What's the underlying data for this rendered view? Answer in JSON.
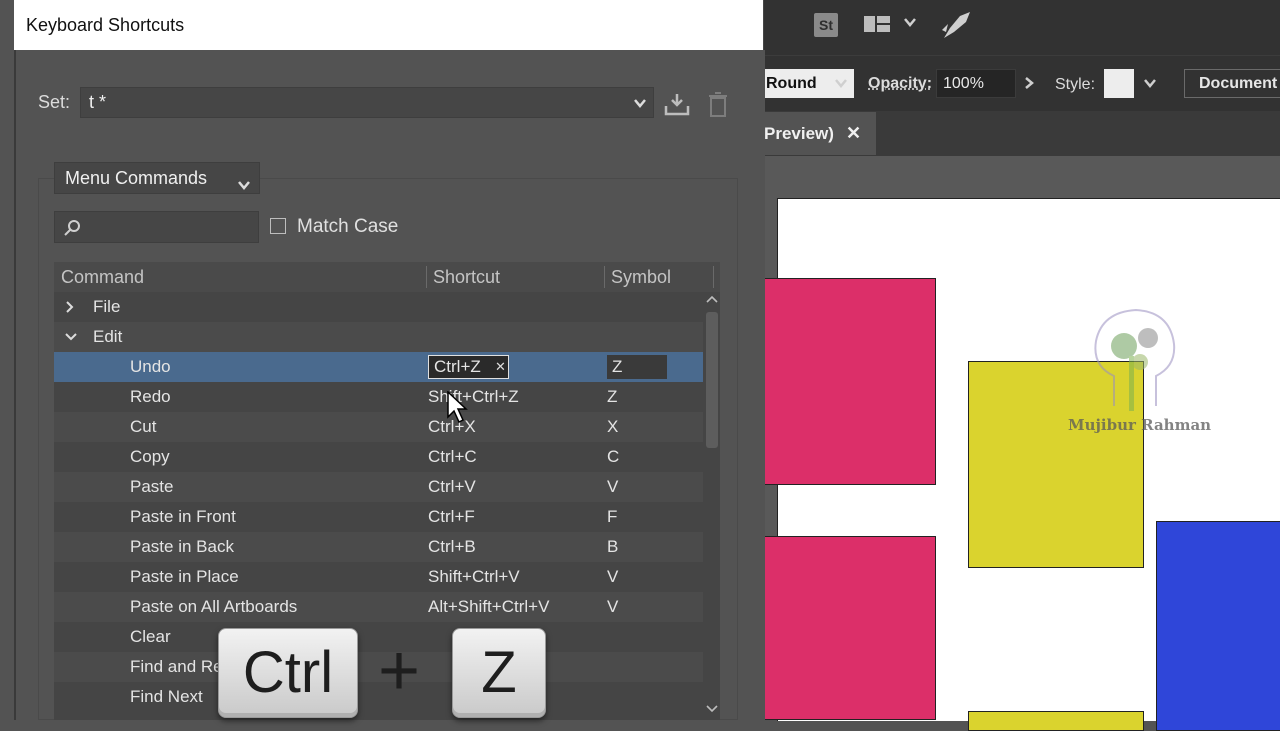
{
  "dialog": {
    "title": "Keyboard Shortcuts",
    "set_label": "Set:",
    "set_value": "t *",
    "category_value": "Menu Commands",
    "search_placeholder": "",
    "match_case_label": "Match Case",
    "match_case_checked": false
  },
  "table": {
    "columns": [
      "Command",
      "Shortcut",
      "Symbol"
    ],
    "rows": [
      {
        "type": "group",
        "expanded": false,
        "label": "File"
      },
      {
        "type": "group",
        "expanded": true,
        "label": "Edit"
      },
      {
        "command": "Undo",
        "shortcut": "Ctrl+Z",
        "symbol": "Z",
        "selected": true
      },
      {
        "command": "Redo",
        "shortcut": "Shift+Ctrl+Z",
        "symbol": "Z"
      },
      {
        "command": "Cut",
        "shortcut": "Ctrl+X",
        "symbol": "X"
      },
      {
        "command": "Copy",
        "shortcut": "Ctrl+C",
        "symbol": "C"
      },
      {
        "command": "Paste",
        "shortcut": "Ctrl+V",
        "symbol": "V"
      },
      {
        "command": "Paste in Front",
        "shortcut": "Ctrl+F",
        "symbol": "F"
      },
      {
        "command": "Paste in Back",
        "shortcut": "Ctrl+B",
        "symbol": "B"
      },
      {
        "command": "Paste in Place",
        "shortcut": "Shift+Ctrl+V",
        "symbol": "V"
      },
      {
        "command": "Paste on All Artboards",
        "shortcut": "Alt+Shift+Ctrl+V",
        "symbol": "V"
      },
      {
        "command": "Clear",
        "shortcut": "",
        "symbol": ""
      },
      {
        "command": "Find and Re",
        "shortcut": "",
        "symbol": ""
      },
      {
        "command": "Find Next",
        "shortcut": "",
        "symbol": ""
      }
    ]
  },
  "app": {
    "stock_badge": "St",
    "brush_value": "Round",
    "opacity_label": "Opacity:",
    "opacity_value": "100%",
    "style_label": "Style:",
    "document_button": "Document S",
    "doc_tab_label": "Preview)"
  },
  "watermark": {
    "text": "Mujibur Rahman"
  },
  "overlay": {
    "key1": "Ctrl",
    "plus": "+",
    "key2": "Z"
  },
  "colors": {
    "pink": "#dc2f69",
    "yellow": "#dad32e",
    "blue": "#2f46d9",
    "selection": "#4a6a8e"
  }
}
